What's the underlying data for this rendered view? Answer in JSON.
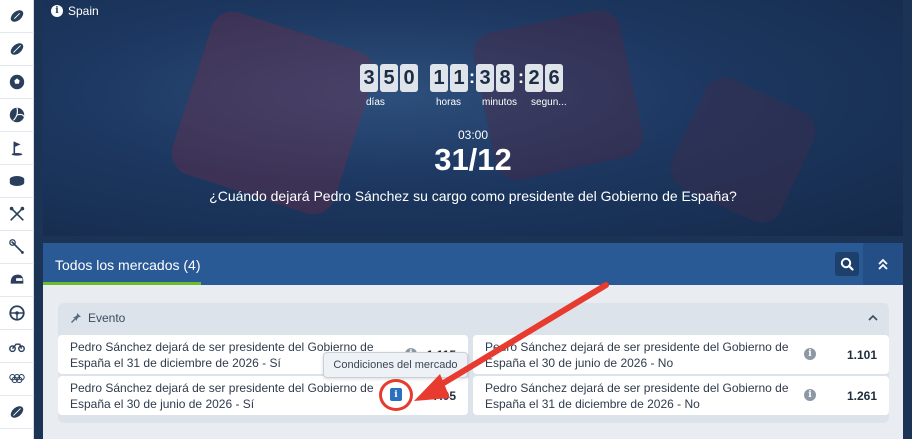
{
  "sidebar": {
    "items": [
      {
        "icon": "football-icon"
      },
      {
        "icon": "rugby-ball-icon"
      },
      {
        "icon": "soccer-ball-icon"
      },
      {
        "icon": "volleyball-icon"
      },
      {
        "icon": "golf-flag-icon"
      },
      {
        "icon": "hockey-puck-icon"
      },
      {
        "icon": "crossed-sticks-icon"
      },
      {
        "icon": "badminton-icon"
      },
      {
        "icon": "helmet-icon"
      },
      {
        "icon": "steering-wheel-icon"
      },
      {
        "icon": "motorbike-icon"
      },
      {
        "icon": "olympic-rings-icon"
      },
      {
        "icon": "rugby-ball-icon"
      }
    ]
  },
  "hero": {
    "country": "Spain",
    "countdown": {
      "days": [
        "3",
        "5",
        "0"
      ],
      "hours": [
        "1",
        "1"
      ],
      "minutes": [
        "3",
        "8"
      ],
      "seconds": [
        "2",
        "6"
      ],
      "labels": {
        "days": "días",
        "hours": "horas",
        "minutes": "minutos",
        "seconds": "segun..."
      }
    },
    "time": "03:00",
    "date": "31/12",
    "question": "¿Cuándo dejará Pedro Sánchez su cargo como presidente del Gobierno de España?"
  },
  "markets": {
    "title": "Todos los mercados (4)",
    "group": {
      "title": "Evento",
      "outcomes": [
        {
          "name": "Pedro Sánchez dejará de ser presidente del Gobierno de España el 31 de diciembre de 2026 - Sí",
          "price": "1.115"
        },
        {
          "name": "Pedro Sánchez dejará de ser presidente del Gobierno de España el 30 de junio de 2026 - No",
          "price": "1.101"
        },
        {
          "name": "Pedro Sánchez dejará de ser presidente del Gobierno de España el 30 de junio de 2026 - Sí",
          "price": "7.05"
        },
        {
          "name": "Pedro Sánchez dejará de ser presidente del Gobierno de España el 31 de diciembre de 2026 - No",
          "price": "1.261"
        }
      ]
    },
    "tooltip": "Condiciones del mercado"
  },
  "colors": {
    "accent": "#2a5a96",
    "tab_underline": "#6cbd2e",
    "annotation": "#e63b2e"
  }
}
